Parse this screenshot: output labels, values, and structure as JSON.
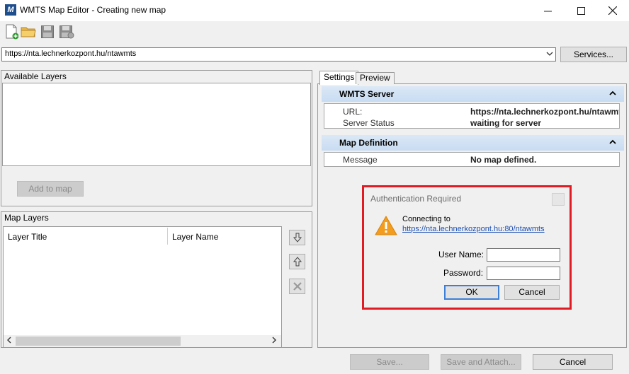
{
  "window": {
    "title": "WMTS Map Editor - Creating new map",
    "app_icon_letter": "M"
  },
  "toolbar": {
    "buttons": [
      "new-document-icon",
      "open-folder-icon",
      "save-icon",
      "save-as-icon"
    ]
  },
  "url_bar": {
    "value": "https://nta.lechnerkozpont.hu/ntawmts",
    "services_label": "Services..."
  },
  "available_layers": {
    "title": "Available Layers",
    "add_button_label": "Add to map"
  },
  "map_layers": {
    "title": "Map Layers",
    "columns": [
      "Layer Title",
      "Layer Name"
    ]
  },
  "tabs": {
    "settings": "Settings",
    "preview": "Preview"
  },
  "wmts_server": {
    "title": "WMTS Server",
    "url_label": "URL:",
    "url_value": "https://nta.lechnerkozpont.hu/ntawmts",
    "status_label": "Server Status",
    "status_value": "waiting for server"
  },
  "map_definition": {
    "title": "Map Definition",
    "message_label": "Message",
    "message_value": "No map defined."
  },
  "auth_dialog": {
    "title": "Authentication Required",
    "connecting_label": "Connecting to",
    "connecting_url": "https://nta.lechnerkozpont.hu:80/ntawmts",
    "username_label": "User Name:",
    "password_label": "Password:",
    "username_value": "",
    "password_value": "",
    "ok_label": "OK",
    "cancel_label": "Cancel",
    "highlight_color": "#e01b24"
  },
  "footer": {
    "save_label": "Save...",
    "save_attach_label": "Save and Attach...",
    "cancel_label": "Cancel"
  }
}
